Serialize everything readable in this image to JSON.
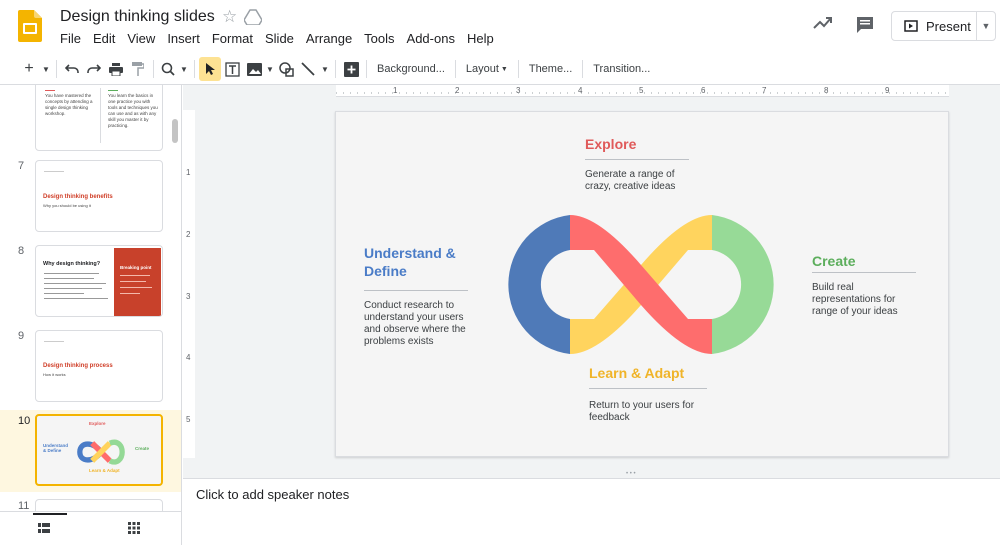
{
  "header": {
    "doc_title": "Design thinking slides",
    "menu": [
      "File",
      "Edit",
      "View",
      "Insert",
      "Format",
      "Slide",
      "Arrange",
      "Tools",
      "Add-ons",
      "Help"
    ],
    "present_label": "Present"
  },
  "toolbar": {
    "background_label": "Background...",
    "layout_label": "Layout",
    "theme_label": "Theme...",
    "transition_label": "Transition..."
  },
  "filmstrip": {
    "slides": [
      {
        "number": "7",
        "title": "Design thinking benefits",
        "subtitle": "Why you should be using it"
      },
      {
        "number": "8",
        "title": "Why design thinking?",
        "box_title": "Breaking point"
      },
      {
        "number": "9",
        "title": "Design thinking process",
        "subtitle": "How it works"
      },
      {
        "number": "10"
      },
      {
        "number": "11"
      }
    ],
    "slide6": {
      "col1": "You have mastered the concepts by attending a single design thinking workshop.",
      "col2": "You learn the basics in one practice you with tools and techniques you can use and as with any skill you master it by practicing."
    }
  },
  "slide": {
    "explore": {
      "title": "Explore",
      "body": "Generate a range of crazy, creative ideas",
      "color": "#e05a5a"
    },
    "understand": {
      "title": "Understand & Define",
      "body": "Conduct research to understand your users and observe where the problems exists",
      "color": "#4a7cc7"
    },
    "create": {
      "title": "Create",
      "body": "Build real representations for range of your ideas",
      "color": "#5cae5c"
    },
    "learn": {
      "title": "Learn & Adapt",
      "body": "Return to your users for feedback",
      "color": "#f0b429"
    }
  },
  "notes": {
    "placeholder": "Click to add speaker notes"
  },
  "ruler_top": [
    "1",
    "2",
    "3",
    "4",
    "5",
    "6",
    "7",
    "8",
    "9"
  ],
  "ruler_left": [
    "1",
    "2",
    "3",
    "4",
    "5"
  ]
}
